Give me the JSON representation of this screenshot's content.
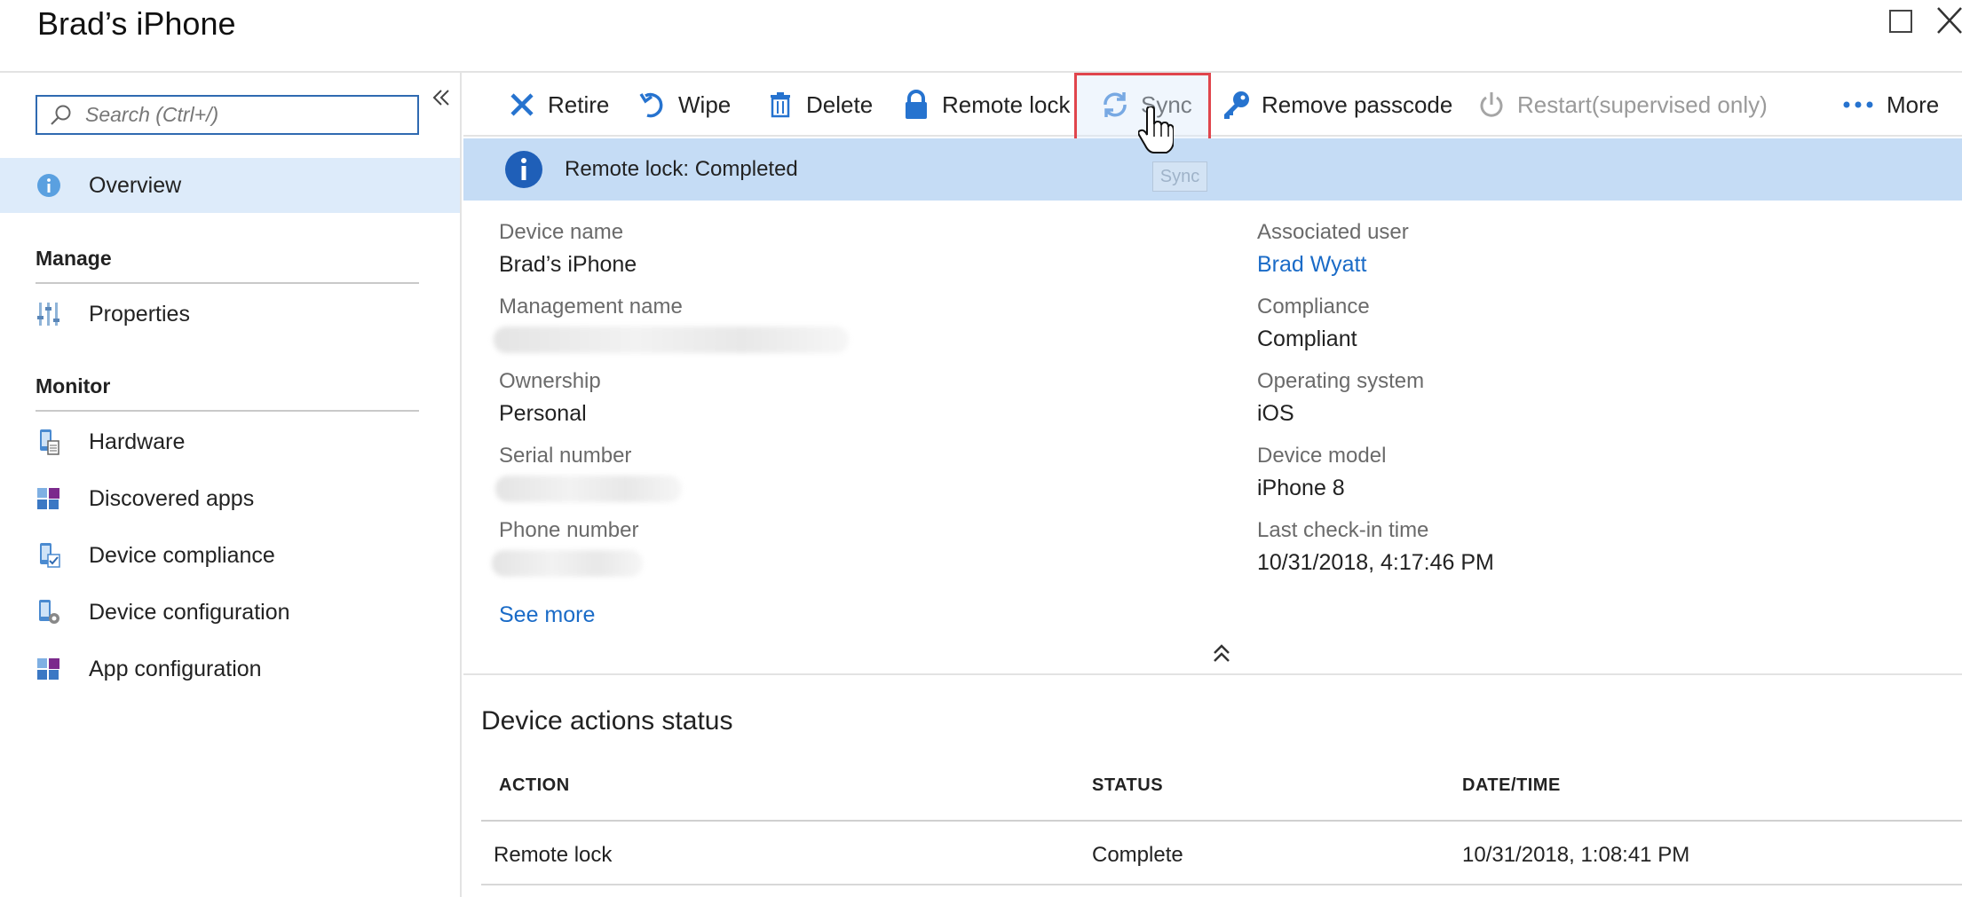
{
  "window": {
    "title": "Brad’s iPhone"
  },
  "sidebar": {
    "search_placeholder": "Search (Ctrl+/)",
    "overview_label": "Overview",
    "sections": [
      {
        "label": "Manage",
        "items": [
          {
            "label": "Properties",
            "icon": "properties-icon"
          }
        ]
      },
      {
        "label": "Monitor",
        "items": [
          {
            "label": "Hardware",
            "icon": "hardware-icon"
          },
          {
            "label": "Discovered apps",
            "icon": "apps-icon"
          },
          {
            "label": "Device compliance",
            "icon": "compliance-icon"
          },
          {
            "label": "Device configuration",
            "icon": "configuration-icon"
          },
          {
            "label": "App configuration",
            "icon": "app-config-icon"
          }
        ]
      }
    ]
  },
  "toolbar": {
    "retire": "Retire",
    "wipe": "Wipe",
    "delete": "Delete",
    "remote_lock": "Remote lock",
    "sync": "Sync",
    "remove_passcode": "Remove passcode",
    "restart": "Restart(supervised only)",
    "more": "More"
  },
  "banner": {
    "text": "Remote lock: Completed",
    "tooltip": "Sync"
  },
  "properties": {
    "left": [
      {
        "label": "Device name",
        "value": "Brad’s iPhone"
      },
      {
        "label": "Management name",
        "value": ""
      },
      {
        "label": "Ownership",
        "value": "Personal"
      },
      {
        "label": "Serial number",
        "value": ""
      },
      {
        "label": "Phone number",
        "value": ""
      }
    ],
    "right": [
      {
        "label": "Associated user",
        "value": "Brad Wyatt"
      },
      {
        "label": "Compliance",
        "value": "Compliant"
      },
      {
        "label": "Operating system",
        "value": "iOS"
      },
      {
        "label": "Device model",
        "value": "iPhone 8"
      },
      {
        "label": "Last check-in time",
        "value": "10/31/2018, 4:17:46 PM"
      }
    ],
    "see_more": "See more"
  },
  "actions_status": {
    "title": "Device actions status",
    "columns": [
      "ACTION",
      "STATUS",
      "DATE/TIME"
    ],
    "rows": [
      {
        "action": "Remote lock",
        "status": "Complete",
        "datetime": "10/31/2018, 1:08:41 PM"
      }
    ]
  },
  "colors": {
    "accent": "#1a6bc7",
    "banner_bg": "#c5dcf5",
    "highlight_box": "#e0454c",
    "active_nav_bg": "#ddebfa"
  }
}
